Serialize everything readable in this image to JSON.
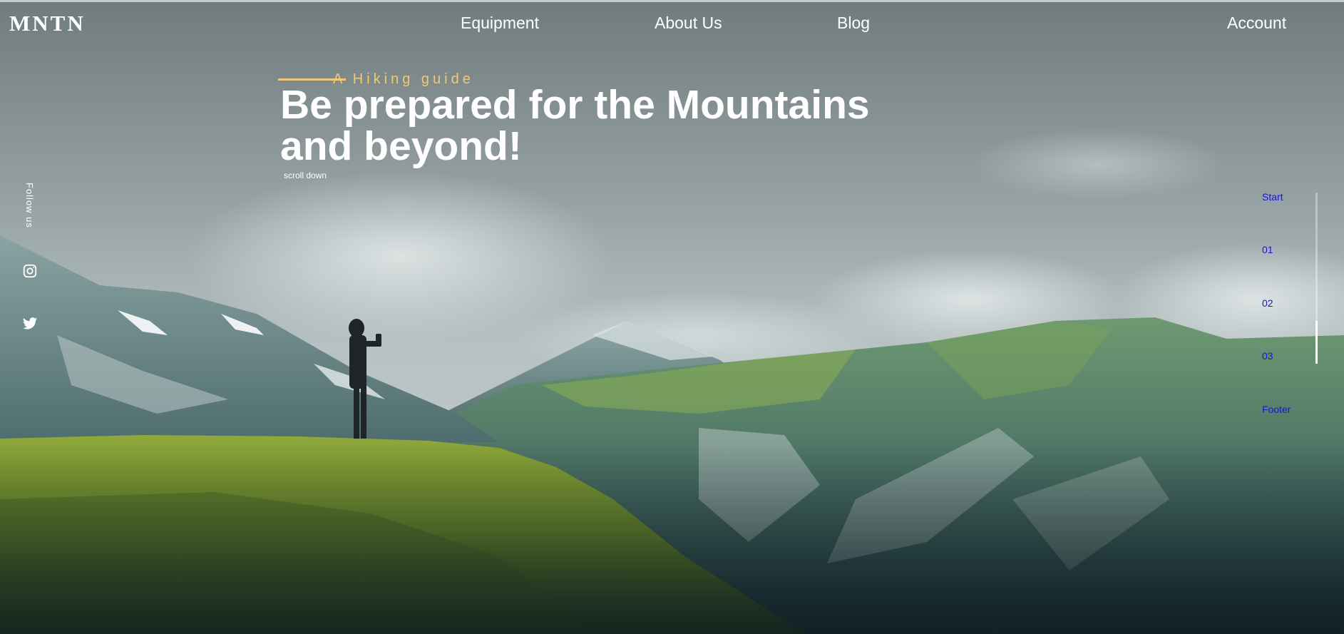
{
  "header": {
    "logo": "MNTN",
    "nav": [
      "Equipment",
      "About Us",
      "Blog"
    ],
    "account": "Account"
  },
  "hero": {
    "subtitle": "A Hiking guide",
    "headline_line1": "Be prepared for the Mountains",
    "headline_line2": "and beyond!",
    "scroll_down": "scroll down"
  },
  "social": {
    "follow_label": "Follow us",
    "icons": [
      "instagram-icon",
      "twitter-icon"
    ]
  },
  "section_nav": {
    "items": [
      "Start",
      "01",
      "02",
      "03",
      "Footer"
    ],
    "progress": 0.25
  },
  "colors": {
    "accent": "#F3C873",
    "text": "#FFFFFF",
    "section_link": "#1717D6"
  }
}
